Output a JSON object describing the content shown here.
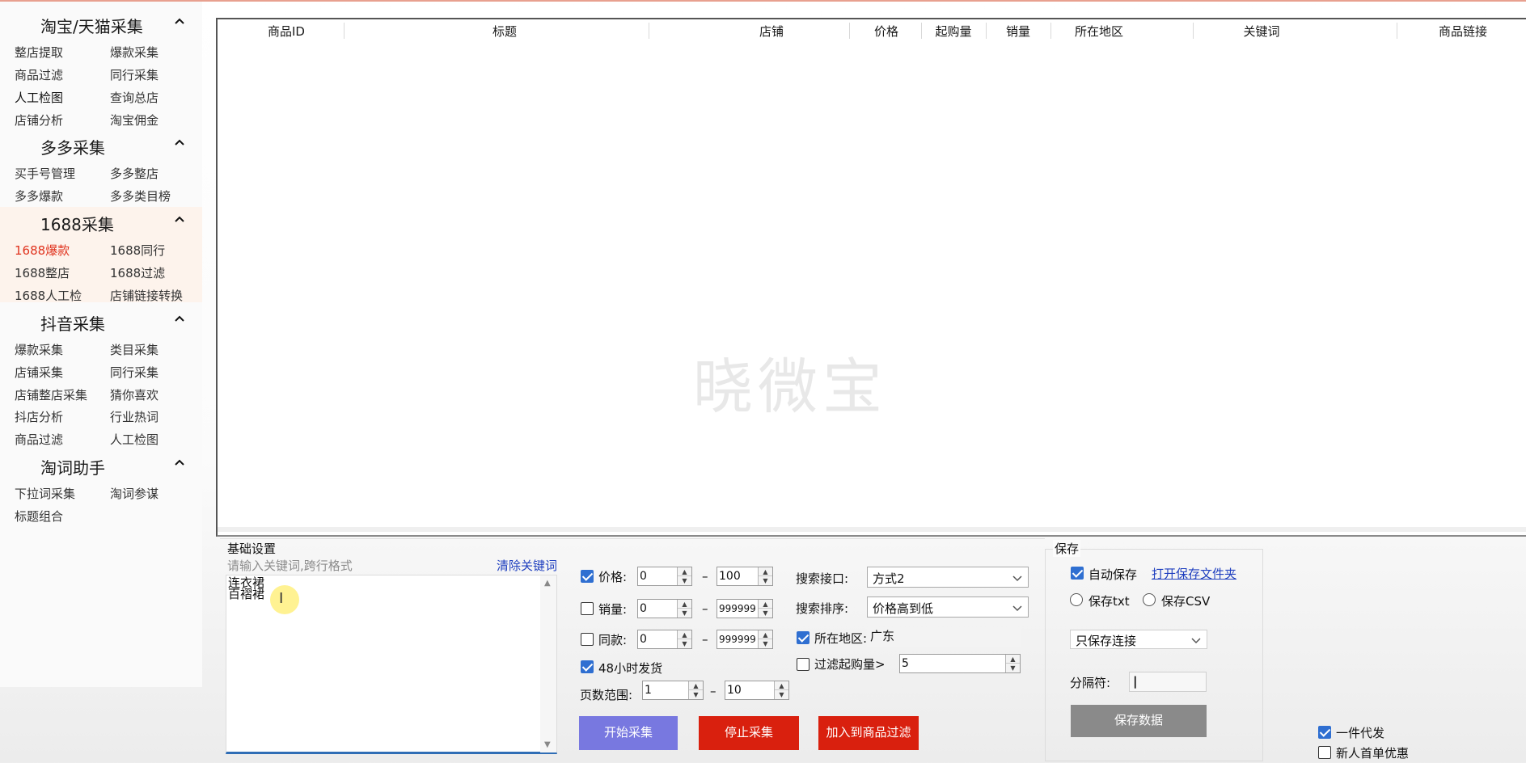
{
  "sidebar": {
    "groups": [
      {
        "title": "淘宝/天猫采集",
        "items": [
          "整店提取",
          "爆款采集",
          "商品过滤",
          "同行采集",
          "人工检图",
          "查询总店",
          "店铺分析",
          "淘宝佣金"
        ]
      },
      {
        "title": "多多采集",
        "items": [
          "买手号管理",
          "多多整店",
          "多多爆款",
          "多多类目榜"
        ]
      },
      {
        "title": "1688采集",
        "items": [
          "1688爆款",
          "1688同行",
          "1688整店",
          "1688过滤",
          "1688人工检",
          "店铺链接转换"
        ]
      },
      {
        "title": "抖音采集",
        "items": [
          "爆款采集",
          "类目采集",
          "店铺采集",
          "同行采集",
          "店铺整店采集",
          "猜你喜欢",
          "抖店分析",
          "行业热词",
          "商品过滤",
          "人工检图"
        ]
      },
      {
        "title": "淘词助手",
        "items": [
          "下拉词采集",
          "淘词参谋",
          "标题组合"
        ]
      }
    ],
    "active_item": "1688爆款"
  },
  "table": {
    "columns": [
      "商品ID",
      "标题",
      "店铺",
      "价格",
      "起购量",
      "销量",
      "所在地区",
      "关键词",
      "商品链接"
    ],
    "watermark": "晓微宝"
  },
  "basic": {
    "section_label": "基础设置",
    "hint": "请输入关键词,跨行格式",
    "clear_link": "清除关键词",
    "keywords": "连衣裙\n百褶裙"
  },
  "filters": {
    "price": {
      "label": "价格:",
      "checked": true,
      "min": "0",
      "max": "100"
    },
    "sales": {
      "label": "销量:",
      "checked": false,
      "min": "0",
      "max": "999999"
    },
    "same": {
      "label": "同款:",
      "checked": false,
      "min": "0",
      "max": "999999"
    },
    "ship48": {
      "label": "48小时发货",
      "checked": true
    },
    "pages": {
      "label": "页数范围:",
      "min": "1",
      "max": "10"
    },
    "dash": "–"
  },
  "search": {
    "api_label": "搜索接口:",
    "api_value": "方式2",
    "sort_label": "搜索排序:",
    "sort_value": "价格高到低",
    "region_label": "所在地区:",
    "region_checked": true,
    "region_value": "广东",
    "moq_label": "过滤起购量>",
    "moq_checked": false,
    "moq_value": "5"
  },
  "actions": {
    "start": "开始采集",
    "stop": "停止采集",
    "add": "加入到商品过滤"
  },
  "save": {
    "section_label": "保存",
    "auto_label": "自动保存",
    "auto_checked": true,
    "open_folder": "打开保存文件夹",
    "txt_label": "保存txt",
    "csv_label": "保存CSV",
    "mode_value": "只保存连接",
    "sep_label": "分隔符:",
    "sep_value": "|",
    "save_button": "保存数据"
  },
  "extra": {
    "dropship_label": "一件代发",
    "dropship_checked": true,
    "newuser_label": "新人首单优惠",
    "newuser_checked": false
  },
  "colors": {
    "accent": "#2f6fd1",
    "danger": "#d9200e",
    "start": "#7878e0",
    "active_item": "#e0321d"
  }
}
